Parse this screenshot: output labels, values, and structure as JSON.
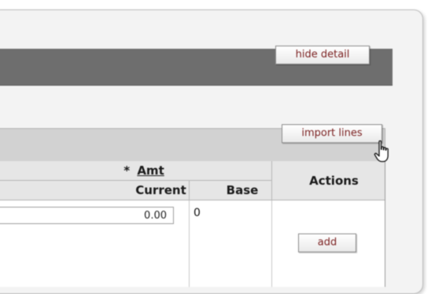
{
  "detail_header": {
    "hide_detail_label": "hide detail"
  },
  "lines_section": {
    "import_lines_label": "import lines",
    "table": {
      "amt_required_marker": "*",
      "amt_header": "Amt",
      "current_header": "Current",
      "base_header": "Base",
      "actions_header": "Actions",
      "row": {
        "current_value": "0.00",
        "base_value": "0"
      },
      "add_label": "add"
    }
  },
  "colors": {
    "header_bar": "#6e6e6e",
    "subheader_bar": "#d2d2d2",
    "button_text": "#7a1f1f"
  },
  "icons": [
    "hand-cursor-icon"
  ]
}
